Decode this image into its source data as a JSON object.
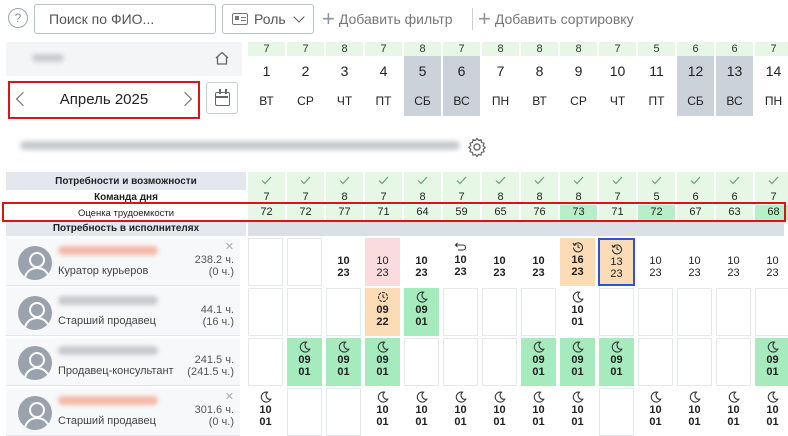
{
  "toolbar": {
    "help": "?",
    "search_placeholder": "Поиск по ФИО...",
    "role_label": "Роль",
    "add_filter": "Добавить фильтр",
    "add_sort": "Добавить сортировку"
  },
  "month_label": "Апрель 2025",
  "days": [
    {
      "num": "1",
      "wd": "ВТ",
      "cnt": "7",
      "weekend": false
    },
    {
      "num": "2",
      "wd": "СР",
      "cnt": "7",
      "weekend": false
    },
    {
      "num": "3",
      "wd": "ЧТ",
      "cnt": "8",
      "weekend": false
    },
    {
      "num": "4",
      "wd": "ПТ",
      "cnt": "7",
      "weekend": false
    },
    {
      "num": "5",
      "wd": "СБ",
      "cnt": "8",
      "weekend": true
    },
    {
      "num": "6",
      "wd": "ВС",
      "cnt": "7",
      "weekend": true
    },
    {
      "num": "7",
      "wd": "ПН",
      "cnt": "8",
      "weekend": false
    },
    {
      "num": "8",
      "wd": "ВТ",
      "cnt": "8",
      "weekend": false
    },
    {
      "num": "9",
      "wd": "СР",
      "cnt": "8",
      "weekend": false
    },
    {
      "num": "10",
      "wd": "ЧТ",
      "cnt": "7",
      "weekend": false
    },
    {
      "num": "11",
      "wd": "ПТ",
      "cnt": "5",
      "weekend": false
    },
    {
      "num": "12",
      "wd": "СБ",
      "cnt": "6",
      "weekend": true
    },
    {
      "num": "13",
      "wd": "ВС",
      "cnt": "6",
      "weekend": true
    },
    {
      "num": "14",
      "wd": "ПН",
      "cnt": "7",
      "weekend": false
    }
  ],
  "summary": {
    "needs_label": "Потребности и возможности",
    "team_label": "Команда дня",
    "labor_label": "Оценка трудоемкости",
    "needs_exec_label": "Потребность в исполнителях",
    "team": [
      "7",
      "7",
      "8",
      "7",
      "8",
      "7",
      "8",
      "8",
      "8",
      "7",
      "5",
      "6",
      "6",
      "7"
    ],
    "labor": [
      "72",
      "72",
      "77",
      "71",
      "64",
      "59",
      "65",
      "76",
      "73",
      "71",
      "72",
      "67",
      "63",
      "68"
    ],
    "labor_hl": [
      false,
      false,
      false,
      false,
      false,
      false,
      false,
      false,
      true,
      false,
      true,
      false,
      false,
      true
    ]
  },
  "employees": [
    {
      "role": "Куратор курьеров",
      "hours": "238.2 ч.",
      "hours2": "(0 ч.)",
      "close": "✕",
      "name_color": "#f3b8a8",
      "cells": [
        {
          "type": "empty"
        },
        {
          "type": "empty"
        },
        {
          "type": "plain",
          "a": "10",
          "b": "23",
          "bold": true
        },
        {
          "type": "pink",
          "a": "10",
          "b": "23"
        },
        {
          "type": "plain",
          "a": "10",
          "b": "23",
          "bold": true
        },
        {
          "type": "plain",
          "a": "10",
          "b": "23",
          "bold": true,
          "icon": "swap"
        },
        {
          "type": "plain",
          "a": "10",
          "b": "23",
          "bold": true
        },
        {
          "type": "plain",
          "a": "10",
          "b": "23",
          "bold": true
        },
        {
          "type": "orange",
          "a": "16",
          "b": "23",
          "icon": "history"
        },
        {
          "type": "sel",
          "a": "13",
          "b": "23",
          "icon": "history"
        },
        {
          "type": "plain",
          "a": "10",
          "b": "23"
        },
        {
          "type": "plain",
          "a": "10",
          "b": "23"
        },
        {
          "type": "plain",
          "a": "10",
          "b": "23"
        },
        {
          "type": "plain",
          "a": "10",
          "b": "23"
        }
      ]
    },
    {
      "role": "Старший продавец",
      "hours": "44.1 ч.",
      "hours2": "(16 ч.)",
      "close": "",
      "name_color": "#c7cace",
      "cells": [
        {
          "type": "empty"
        },
        {
          "type": "empty"
        },
        {
          "type": "empty"
        },
        {
          "type": "orange",
          "a": "09",
          "b": "22",
          "icon": "clock"
        },
        {
          "type": "green",
          "a": "09",
          "b": "01",
          "icon": "moon"
        },
        {
          "type": "empty"
        },
        {
          "type": "empty"
        },
        {
          "type": "empty"
        },
        {
          "type": "plain",
          "a": "10",
          "b": "01",
          "bold": true,
          "icon": "moon"
        },
        {
          "type": "empty"
        },
        {
          "type": "empty"
        },
        {
          "type": "empty"
        },
        {
          "type": "empty"
        },
        {
          "type": "empty"
        }
      ]
    },
    {
      "role": "Продавец-консультант",
      "hours": "241.5 ч.",
      "hours2": "(241.5 ч.)",
      "close": "",
      "name_color": "#c7cace",
      "cells": [
        {
          "type": "empty"
        },
        {
          "type": "green",
          "a": "09",
          "b": "01",
          "icon": "moon"
        },
        {
          "type": "green",
          "a": "09",
          "b": "01",
          "icon": "moon"
        },
        {
          "type": "green",
          "a": "09",
          "b": "01",
          "icon": "moon"
        },
        {
          "type": "empty"
        },
        {
          "type": "empty"
        },
        {
          "type": "empty"
        },
        {
          "type": "green",
          "a": "09",
          "b": "01",
          "icon": "moon"
        },
        {
          "type": "green",
          "a": "09",
          "b": "01",
          "icon": "moon"
        },
        {
          "type": "green",
          "a": "09",
          "b": "01",
          "icon": "moon"
        },
        {
          "type": "empty"
        },
        {
          "type": "empty"
        },
        {
          "type": "empty"
        },
        {
          "type": "green",
          "a": "09",
          "b": "01",
          "icon": "moon"
        }
      ]
    },
    {
      "role": "Старший продавец",
      "hours": "301.6 ч.",
      "hours2": "(0 ч.)",
      "close": "✕",
      "name_color": "#f3b8a8",
      "cells": [
        {
          "type": "plain",
          "a": "10",
          "b": "01",
          "bold": true,
          "icon": "moon"
        },
        {
          "type": "empty"
        },
        {
          "type": "empty"
        },
        {
          "type": "plain",
          "a": "10",
          "b": "01",
          "bold": true,
          "icon": "moon"
        },
        {
          "type": "plain",
          "a": "10",
          "b": "01",
          "bold": true,
          "icon": "moon"
        },
        {
          "type": "plain",
          "a": "10",
          "b": "01",
          "bold": true,
          "icon": "moon"
        },
        {
          "type": "plain",
          "a": "10",
          "b": "01",
          "bold": true,
          "icon": "moon"
        },
        {
          "type": "plain",
          "a": "10",
          "b": "01",
          "bold": true,
          "icon": "moon"
        },
        {
          "type": "plain",
          "a": "10",
          "b": "01",
          "bold": true,
          "icon": "moon"
        },
        {
          "type": "empty"
        },
        {
          "type": "plain",
          "a": "10",
          "b": "01",
          "bold": true,
          "icon": "moon"
        },
        {
          "type": "plain",
          "a": "10",
          "b": "01",
          "bold": true,
          "icon": "moon"
        },
        {
          "type": "plain",
          "a": "10",
          "b": "01",
          "bold": true,
          "icon": "moon"
        },
        {
          "type": "plain",
          "a": "10",
          "b": "01",
          "bold": true,
          "icon": "moon"
        }
      ]
    }
  ]
}
